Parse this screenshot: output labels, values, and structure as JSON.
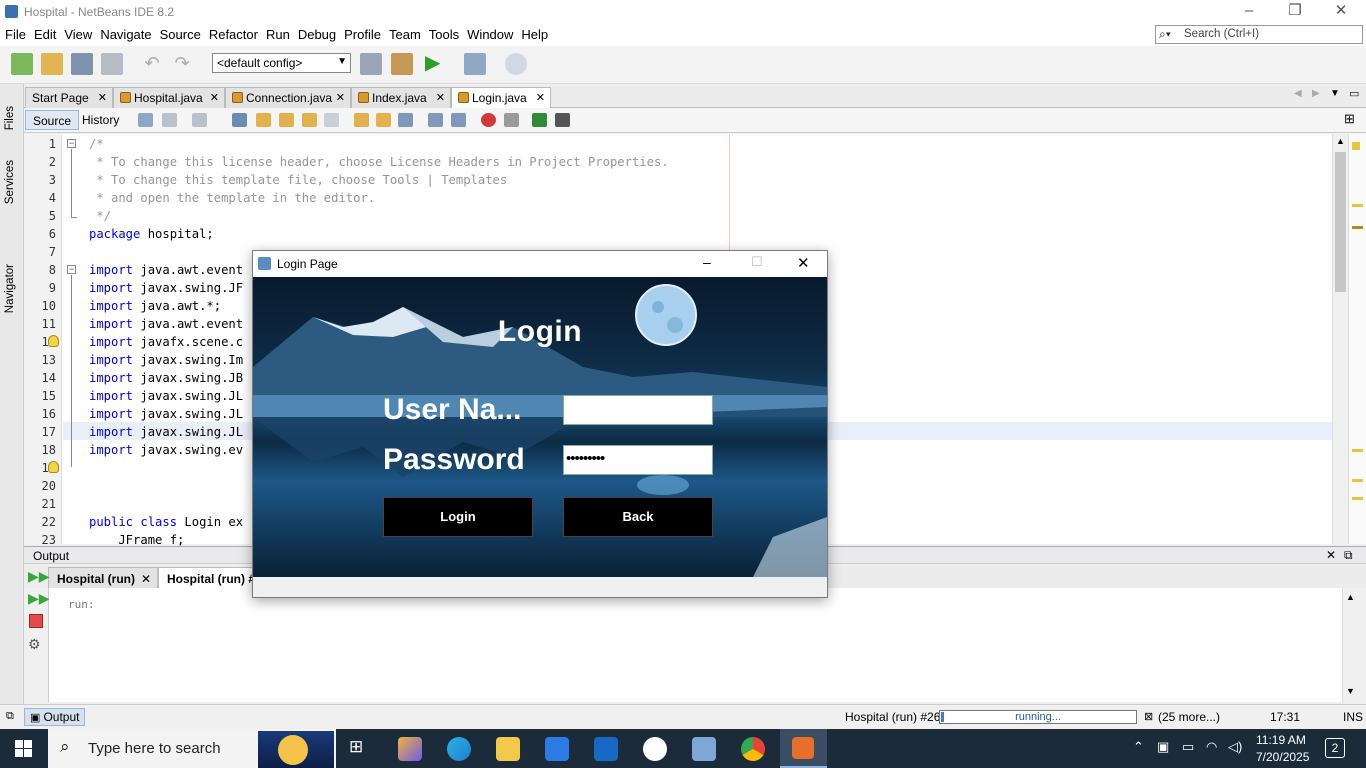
{
  "window": {
    "title": "Hospital - NetBeans IDE 8.2"
  },
  "menu": [
    "File",
    "Edit",
    "View",
    "Navigate",
    "Source",
    "Refactor",
    "Run",
    "Debug",
    "Profile",
    "Team",
    "Tools",
    "Window",
    "Help"
  ],
  "search": {
    "placeholder": "Search (Ctrl+I)"
  },
  "toolbar": {
    "config": "<default config>"
  },
  "side_tabs": [
    "Files",
    "Services",
    "Navigator"
  ],
  "editor_tabs": [
    "Start Page",
    "Hospital.java",
    "Connection.java",
    "Index.java",
    "Login.java"
  ],
  "editor_toolbar": {
    "source": "Source",
    "history": "History"
  },
  "code": {
    "line_numbers": [
      "1",
      "2",
      "3",
      "4",
      "5",
      "6",
      "7",
      "8",
      "9",
      "10",
      "11",
      "12",
      "13",
      "14",
      "15",
      "16",
      "17",
      "18",
      "19",
      "20",
      "21",
      "22",
      "23"
    ],
    "l1": "/*",
    "l2": " * To change this license header, choose License Headers in Project Properties.",
    "l3": " * To change this template file, choose Tools | Templates",
    "l4": " * and open the template in the editor.",
    "l5": " */",
    "l6_kw": "package",
    "l6": " hospital;",
    "import_kw": "import",
    "l8": " java.awt.event",
    "l9": " javax.swing.JF",
    "l10": " java.awt.*;",
    "l11": " java.awt.event",
    "l12": " javafx.scene.c",
    "l13": " javax.swing.Im",
    "l14": " javax.swing.JB",
    "l15": " javax.swing.JL",
    "l16": " javax.swing.JL",
    "l17": " javax.swing.JL",
    "l18": " javax.swing.ev",
    "l22_kw": "public class",
    "l22": " Login ex",
    "l23": "    JFrame f;"
  },
  "output": {
    "title": "Output",
    "tabs": [
      "Hospital (run)",
      "Hospital (run) #"
    ],
    "text": "run:"
  },
  "login_dialog": {
    "title": "Login Page",
    "heading": "Login",
    "username_label": "User Na...",
    "username_value": "",
    "password_label": "Password",
    "password_value": "•••••••••",
    "login_button": "Login",
    "back_button": "Back"
  },
  "statusbar": {
    "output_tab": "Output",
    "process": "Hospital (run) #26",
    "progress_label": "running...",
    "more": "(25 more...)",
    "position": "17:31",
    "mode": "INS"
  },
  "taskbar": {
    "search_placeholder": "Type here to search",
    "time": "11:19 AM",
    "date": "7/20/2025",
    "notifications": "2"
  },
  "colors": {
    "accent": "#3d7cc9",
    "keyword": "#0000e6",
    "comment": "#969696",
    "taskbar": "#1c2b3a"
  }
}
